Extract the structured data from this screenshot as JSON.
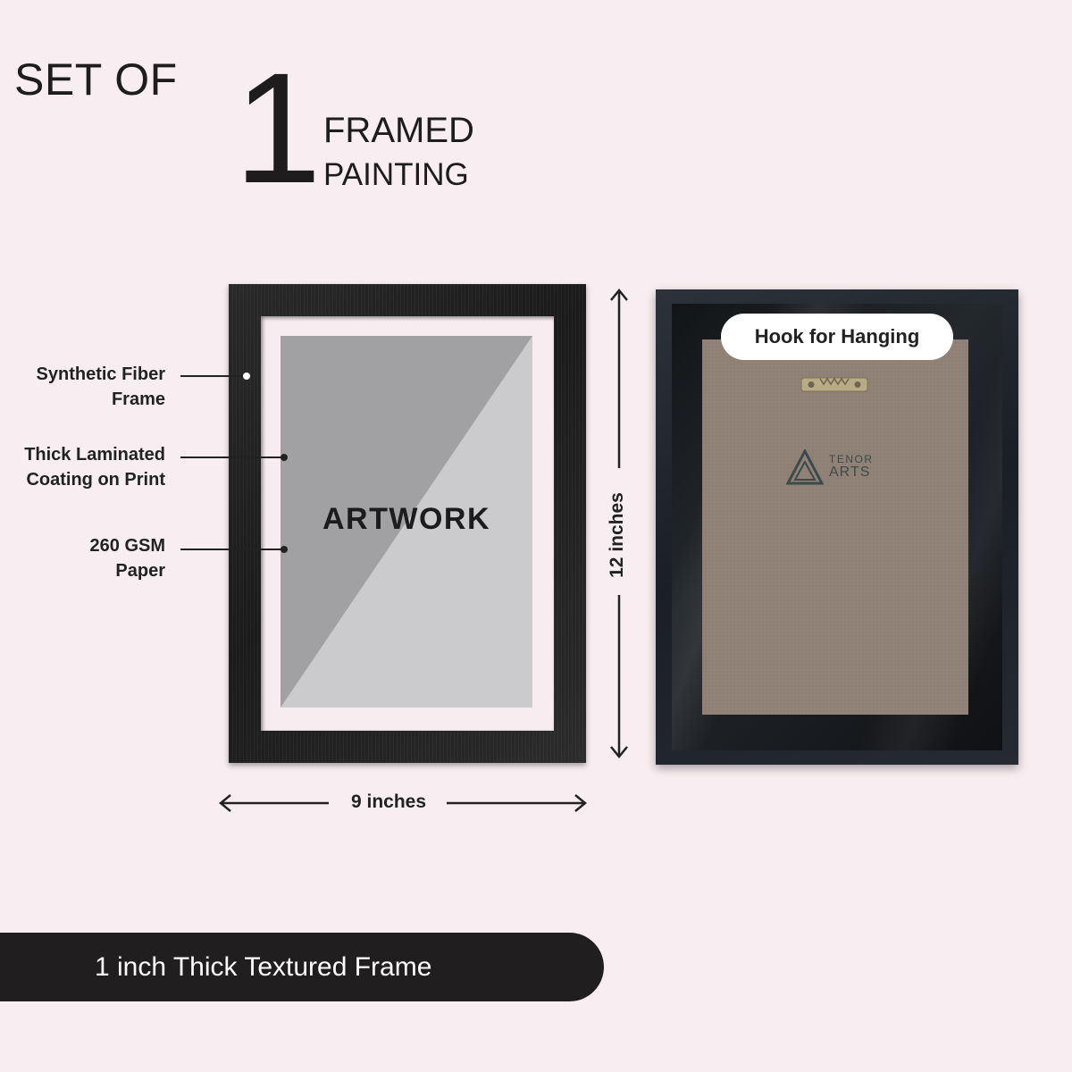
{
  "header": {
    "set_of": "SET OF",
    "count": "1",
    "framed": "FRAMED",
    "painting": "PAINTING"
  },
  "front": {
    "artwork_label": "ARTWORK",
    "callouts": [
      {
        "line1": "Synthetic Fiber",
        "line2": "Frame"
      },
      {
        "line1": "Thick Laminated",
        "line2": "Coating on Print"
      },
      {
        "line1": "260 GSM",
        "line2": "Paper"
      }
    ],
    "width_label": "9 inches",
    "height_label": "12 inches"
  },
  "back": {
    "hook_label": "Hook for Hanging",
    "logo": {
      "top": "TENOR",
      "bottom": "ARTS"
    }
  },
  "banner": {
    "text": "1 inch Thick Textured Frame"
  },
  "colors": {
    "background": "#f8eef1",
    "frame": "#1e1e1e",
    "banner": "#211e1f",
    "board": "#8e8074"
  }
}
